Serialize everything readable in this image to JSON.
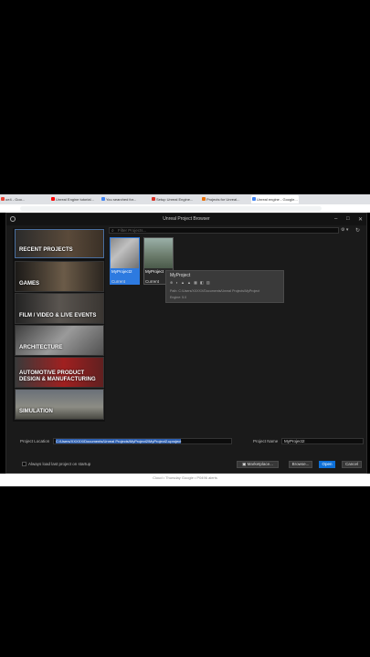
{
  "browser": {
    "tabs": [
      {
        "label": "ue4 - Goo...",
        "color": "#ea4335"
      },
      {
        "label": "Unreal Engine tutorial...",
        "color": "#ff0000"
      },
      {
        "label": "You searched for...",
        "color": "#4285f4"
      },
      {
        "label": "Setup Unreal Engine...",
        "color": "#d93025"
      },
      {
        "label": "Projects for Unreal...",
        "color": "#e8710a"
      },
      {
        "label": "Unreal engine - Google...",
        "color": "#4285f4"
      }
    ]
  },
  "window": {
    "title": "Unreal Project Browser",
    "minimize": "–",
    "maximize": "□",
    "close": "✕"
  },
  "categories": [
    {
      "label": "RECENT PROJECTS"
    },
    {
      "label": "GAMES"
    },
    {
      "label": "FILM / VIDEO & LIVE EVENTS"
    },
    {
      "label": "ARCHITECTURE"
    },
    {
      "label": "AUTOMOTIVE PRODUCT DESIGN & MANUFACTURING"
    },
    {
      "label": "SIMULATION"
    }
  ],
  "filter": {
    "placeholder": "Filter Projects...",
    "settings_label": "⚙ ▾"
  },
  "projects": [
    {
      "name": "MyProject2",
      "version": "Current"
    },
    {
      "name": "MyProject",
      "version": "Current"
    }
  ],
  "tooltip": {
    "name": "MyProject",
    "icons": "⊕ ◐ ▲ ▲ ▦ ◧ ▥",
    "path": "Path: C:/Users/XXXXX/Documents/Unreal Projects/MyProject",
    "engine": "Engine: 5.0"
  },
  "bottom": {
    "location_label": "Project Location",
    "location_value": "C:/Users/XXXXX/Documents/Unreal Projects/MyProject2/MyProject2.uproject",
    "name_label": "Project Name",
    "name_value": "MyProject2",
    "always_load_label": "Always load last project on startup",
    "marketplace_label": "Marketplace...",
    "browse_label": "Browse...",
    "open_label": "Open",
    "cancel_label": "Cancel"
  },
  "statusbar": {
    "text": "Cloud • Thursday Google • P0496 alerts"
  }
}
